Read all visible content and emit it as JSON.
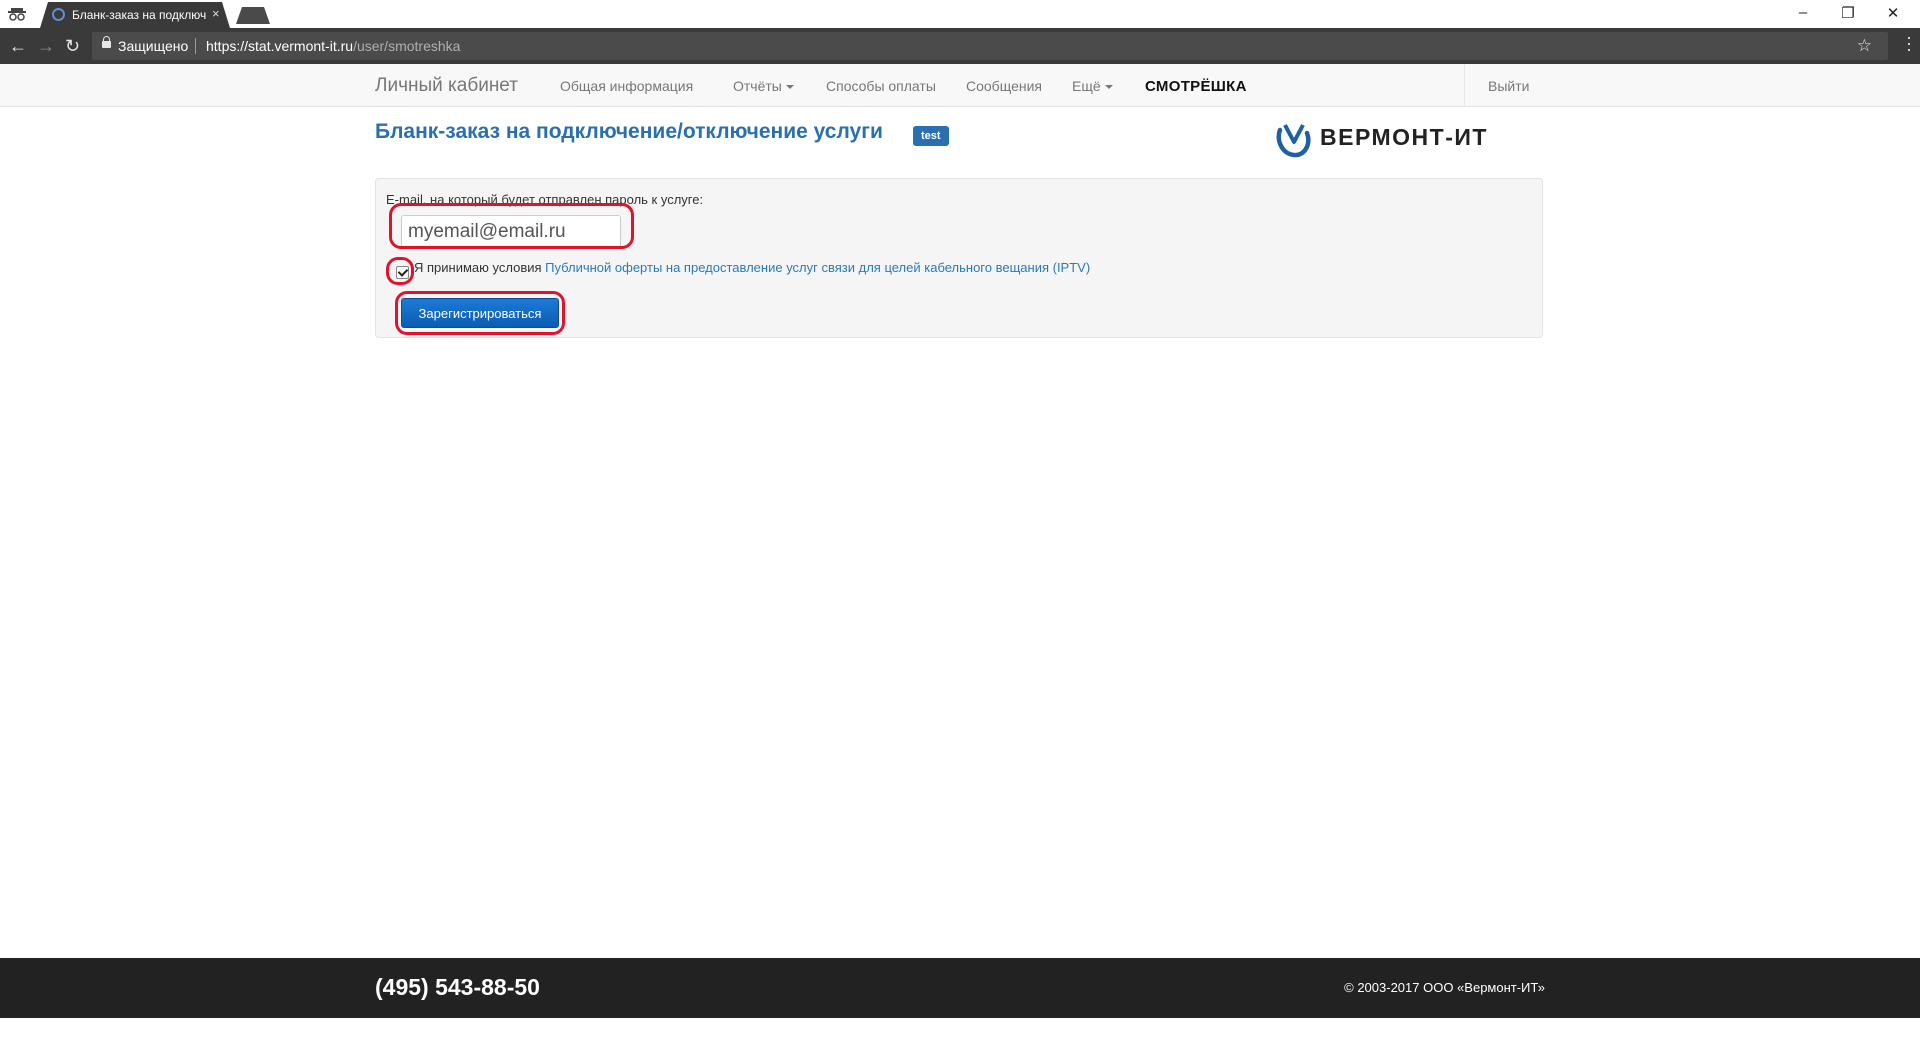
{
  "browser": {
    "tab_title": "Бланк-заказ на подключ...",
    "tab_close": "×",
    "secure_label": "Защищено",
    "url_host": "https://stat.vermont-it.ru",
    "url_path": "/user/smotreshka",
    "star": "☆",
    "minimize": "–",
    "restore": "❐",
    "close": "✕",
    "back": "←",
    "forward": "→",
    "reload": "↻"
  },
  "nav": {
    "brand": "Личный кабинет",
    "general": "Общая информация",
    "reports": "Отчёты",
    "payment": "Способы оплаты",
    "messages": "Сообщения",
    "more": "Ещё",
    "partner": "СМОТРЁШКА",
    "logout": "Выйти"
  },
  "page": {
    "title": "Бланк-заказ на подключение/отключение услуги",
    "badge": "test",
    "logo_text": "ВЕРМОНТ-ИТ"
  },
  "form": {
    "email_label": "E-mail, на который будет отправлен пароль к услуге:",
    "email_value": "myemail@email.ru",
    "accept_prefix": "Я принимаю условия ",
    "offer_link": "Публичной оферты на предоставление услуг связи для целей кабельного вещания (IPTV)",
    "submit_label": "Зарегистрироваться",
    "accept_checked": true
  },
  "footer": {
    "phone": "(495) 543-88-50",
    "copyright": "© 2003-2017 ООО «Вермонт-ИТ»"
  },
  "colors": {
    "accent": "#2a6fb0",
    "highlight": "#e3122b",
    "footer_bg": "#222222"
  }
}
